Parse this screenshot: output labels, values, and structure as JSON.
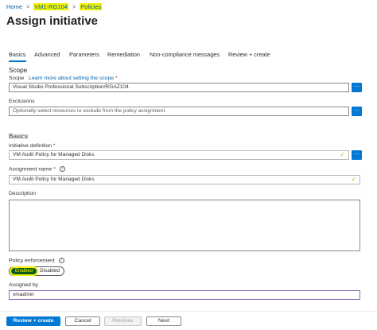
{
  "breadcrumb": {
    "home": "Home",
    "resource_group": "VM1-RG104",
    "policies": "Policies",
    "separator": ">"
  },
  "page": {
    "title": "Assign initiative",
    "more": "..."
  },
  "tabs": [
    {
      "label": "Basics"
    },
    {
      "label": "Advanced"
    },
    {
      "label": "Parameters"
    },
    {
      "label": "Remediation"
    },
    {
      "label": "Non-compliance messages"
    },
    {
      "label": "Review + create"
    }
  ],
  "scope_section": {
    "heading": "Scope",
    "scope_label": "Scope",
    "scope_link": "Learn more about setting the scope",
    "required": "*",
    "scope_value": "Visual Studio Professional Subscription/RGAZ104",
    "exclusions_label": "Exclusions",
    "exclusions_placeholder": "Optionally select resources to exclude from the policy assignment."
  },
  "basics_section": {
    "heading": "Basics",
    "initiative_label": "Initiative definition",
    "initiative_value": "VM Audit Policy for Managed Disks",
    "assignment_label": "Assignment name",
    "assignment_value": "VM Audit Policy for Managed Disks",
    "description_label": "Description",
    "enforcement_label": "Policy enforcement",
    "enforcement_options": [
      "Enabled",
      "Disabled"
    ],
    "enforcement_selected": "Enabled",
    "assigned_by_label": "Assigned by",
    "assigned_by_value": "vmadmin",
    "required": "*",
    "info": "i",
    "browse": "...",
    "valid_mark": "✓"
  },
  "footer": {
    "review_create": "Review + create",
    "cancel": "Cancel",
    "previous": "Previous",
    "next": "Next"
  },
  "colors": {
    "accent": "#0078d4",
    "highlight": "#f3f000",
    "valid": "#8cbd18",
    "enabled_toggle": "#0b5a1e"
  }
}
